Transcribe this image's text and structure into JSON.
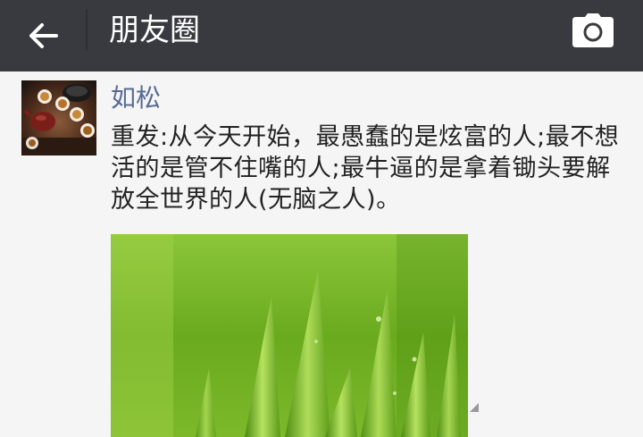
{
  "header": {
    "title": "朋友圈",
    "back_icon": "arrow-left-icon",
    "camera_icon": "camera-icon",
    "bg_color": "#393a3f"
  },
  "post": {
    "author": "如松",
    "author_color": "#576b95",
    "text": "重发:从今天开始，最愚蠢的是炫富的人;最不想活的是管不住嘴的人;最牛逼的是拿着锄头要解放全世界的人(无脑之人)。",
    "avatar_icon": "tea-set-avatar",
    "image_icon": "green-grass-photo"
  }
}
